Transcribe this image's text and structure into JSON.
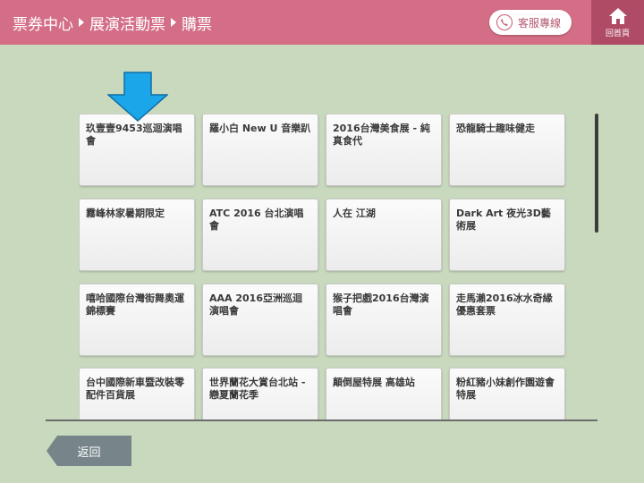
{
  "header": {
    "breadcrumb": [
      "票券中心",
      "展演活動票",
      "購票"
    ],
    "support_label": "客服專線",
    "home_label": "回首頁"
  },
  "tiles": [
    "玖壹壹9453巡迴演唱會",
    "羅小白 New U 音樂趴",
    "2016台灣美食展 - 純真食代",
    "恐龍騎士趣味健走",
    "霧峰林家暑期限定",
    "ATC 2016 台北演唱會",
    "人在 江湖",
    "Dark Art 夜光3D藝術展",
    "嘻哈國際台灣街舞奧運錦標賽",
    "AAA 2016亞洲巡迴演唱會",
    "猴子把戲2016台灣演唱會",
    "走馬瀨2016冰水奇緣優惠套票",
    "台中國際新車暨改裝零配件百貨展",
    "世界蘭花大賞台北站 - 戀夏蘭花季",
    "顛倒屋特展 高雄站",
    "粉紅豬小妹創作園遊會特展"
  ],
  "footer": {
    "back_label": "返回"
  },
  "colors": {
    "header_bg": "#d46e86",
    "home_bg": "#b04b66",
    "page_bg": "#c8d9bd",
    "pointer_arrow": "#1ba6ea"
  },
  "icons": {
    "phone": "phone-icon",
    "home": "home-icon",
    "pointer": "pointer-arrow-icon"
  }
}
